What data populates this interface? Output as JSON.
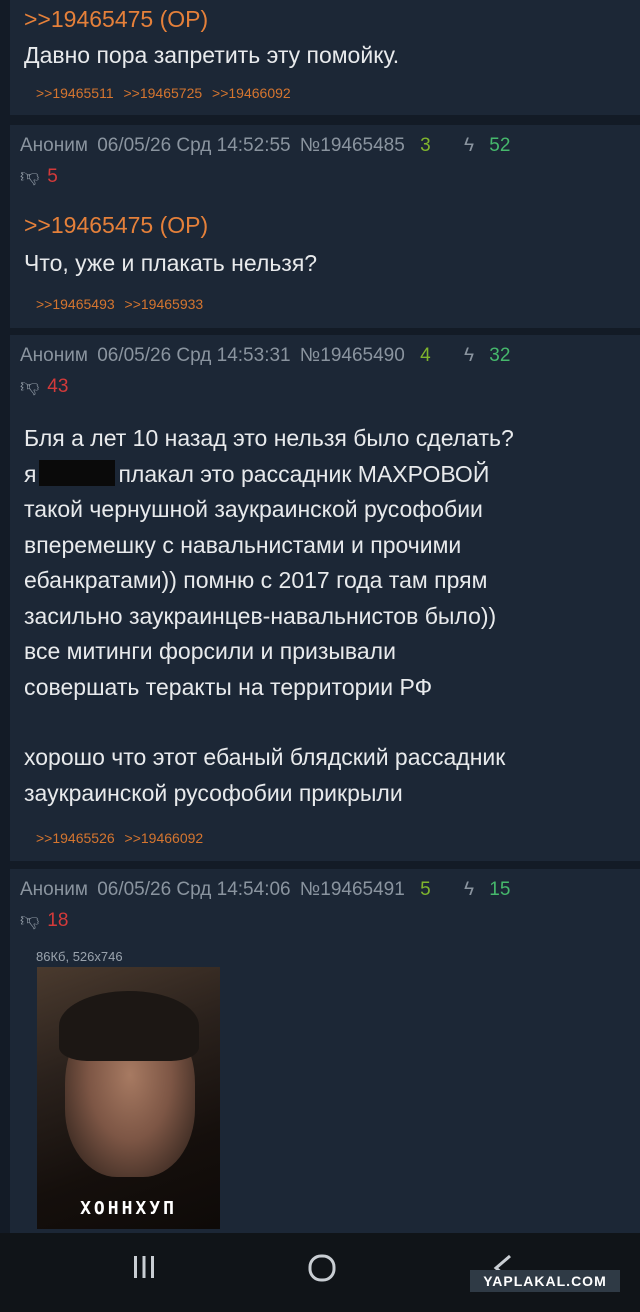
{
  "posts": [
    {
      "quote": ">>19465475 (OP)",
      "text": "Давно пора запретить эту помойку.",
      "refs": [
        ">>19465511",
        ">>19465725",
        ">>19466092"
      ]
    },
    {
      "author": "Аноним",
      "date": "06/05/26 Срд 14:52:55",
      "num": "№19465485",
      "replies": "3",
      "likes": "52",
      "dislikes": "5",
      "quote": ">>19465475 (OP)",
      "text": "Что, уже и плакать нельзя?",
      "refs": [
        ">>19465493",
        ">>19465933"
      ]
    },
    {
      "author": "Аноним",
      "date": "06/05/26 Срд 14:53:31",
      "num": "№19465490",
      "replies": "4",
      "likes": "32",
      "dislikes": "43",
      "lines": [
        "Бля а лет 10 назад это нельзя было сделать?",
        "я",
        "плакал это рассадник МАХРОВОЙ",
        "такой чернушной заукраинской русофобии",
        "вперемешку с навальнистами и прочими",
        "ебанкратами)) помню с 2017 года там прям",
        "засильно заукраинцев-навальнистов было))",
        "все митинги форсили и призывали",
        "совершать теракты на территории РФ",
        "хорошо что этот ебаный блядский рассадник",
        "заукраинской русофобии прикрыли"
      ],
      "refs": [
        ">>19465526",
        ">>19466092"
      ]
    },
    {
      "author": "Аноним",
      "date": "06/05/26 Срд 14:54:06",
      "num": "№19465491",
      "replies": "5",
      "likes": "15",
      "dislikes": "18",
      "file_info": "86Кб, 526x746",
      "image_caption": "ХОННХУП"
    }
  ],
  "navbar": {
    "recents_icon": "recents-icon",
    "home_icon": "home-icon",
    "back_icon": "back-icon"
  },
  "watermark": "YAPLAKAL.COM"
}
